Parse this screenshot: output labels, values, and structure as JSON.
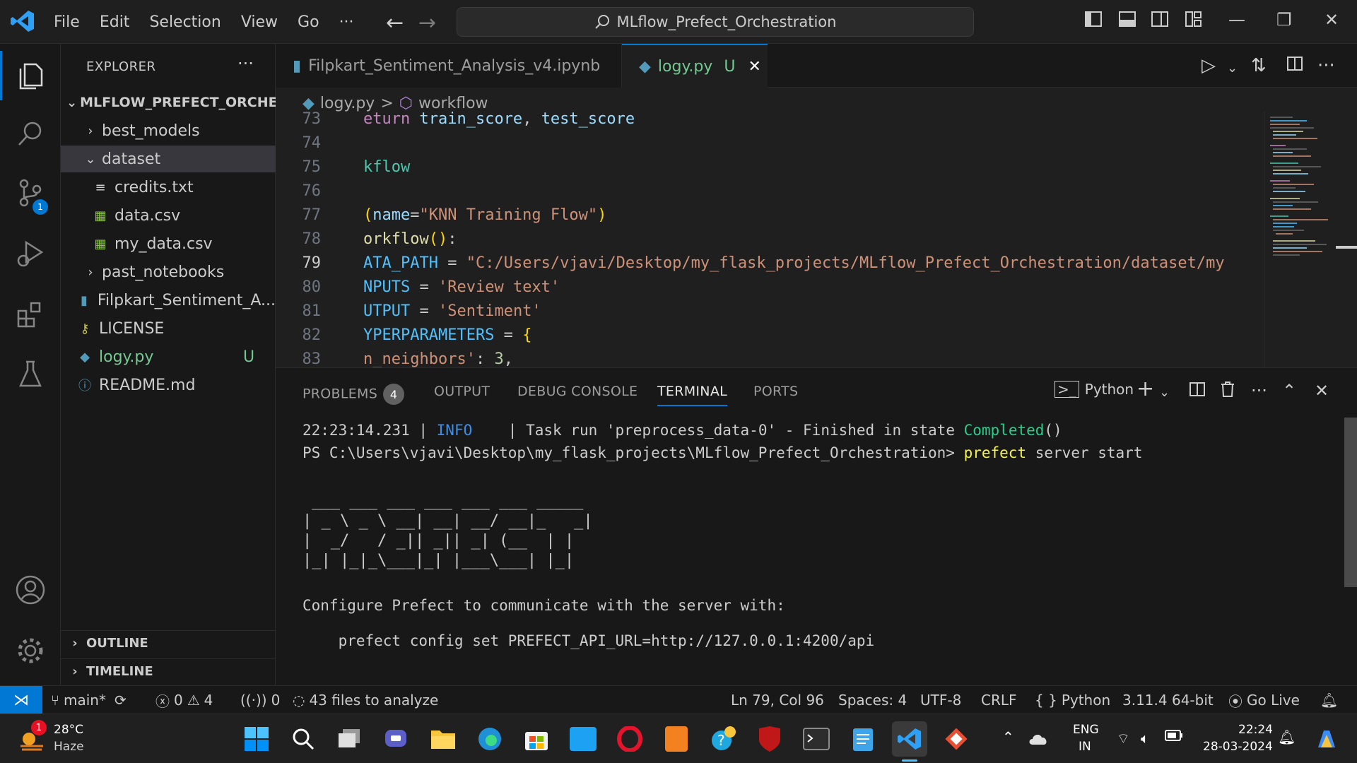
{
  "titlebar": {
    "menu": [
      "File",
      "Edit",
      "Selection",
      "View",
      "Go"
    ],
    "more": "···",
    "search_text": "MLflow_Prefect_Orchestration"
  },
  "sidebar": {
    "title": "EXPLORER",
    "more": "···",
    "root": "MLFLOW_PREFECT_ORCHE...",
    "items": [
      {
        "label": "best_models",
        "type": "folder-collapsed"
      },
      {
        "label": "dataset",
        "type": "folder-expanded"
      },
      {
        "label": "credits.txt",
        "type": "txt"
      },
      {
        "label": "data.csv",
        "type": "csv"
      },
      {
        "label": "my_data.csv",
        "type": "csv"
      },
      {
        "label": "past_notebooks",
        "type": "folder-collapsed"
      },
      {
        "label": "Filpkart_Sentiment_A...",
        "type": "notebook"
      },
      {
        "label": "LICENSE",
        "type": "license"
      },
      {
        "label": "logy.py",
        "type": "python",
        "status": "U"
      },
      {
        "label": "README.md",
        "type": "info"
      }
    ],
    "outline": "OUTLINE",
    "timeline": "TIMELINE"
  },
  "tabs": [
    {
      "label": "Filpkart_Sentiment_Analysis_v4.ipynb",
      "active": false
    },
    {
      "label": "logy.py",
      "status": "U",
      "active": true
    }
  ],
  "breadcrumb": {
    "file": "logy.py",
    "separator": ">",
    "symbol": "workflow"
  },
  "code": [
    {
      "ln": "73",
      "text": "eturn train_score, test_score"
    },
    {
      "ln": "74",
      "text": ""
    },
    {
      "ln": "75",
      "text": "kflow"
    },
    {
      "ln": "76",
      "text": ""
    },
    {
      "ln": "77",
      "text": "(name=\"KNN Training Flow\")"
    },
    {
      "ln": "78",
      "text": "orkflow():"
    },
    {
      "ln": "79",
      "text": "ATA_PATH = \"C:/Users/vjavi/Desktop/my_flask_projects/MLflow_Prefect_Orchestration/dataset/my"
    },
    {
      "ln": "80",
      "text": "NPUTS = 'Review text'"
    },
    {
      "ln": "81",
      "text": "UTPUT = 'Sentiment'"
    },
    {
      "ln": "82",
      "text": "YPERPARAMETERS = {"
    },
    {
      "ln": "83",
      "text": "n_neighbors': 3,"
    }
  ],
  "panel": {
    "tabs": [
      "PROBLEMS",
      "OUTPUT",
      "DEBUG CONSOLE",
      "TERMINAL",
      "PORTS"
    ],
    "problems_count": "4",
    "active": "TERMINAL",
    "shell": "Python"
  },
  "terminal": {
    "line1_time": "22:23:14.231 | ",
    "line1_level": "INFO",
    "line1_msg": "    | Task run 'preprocess_data-0' - Finished in state ",
    "line1_state": "Completed",
    "line1_end": "()",
    "prompt": "PS C:\\Users\\vjavi\\Desktop\\my_flask_projects\\MLflow_Prefect_Orchestration> ",
    "cmd_word": "prefect",
    "cmd_rest": " server start",
    "banner": [
      " ___ ___ ___ ___ ___ ___ _____",
      "| _ \\ _ \\ __| __| __/ __|_   _|",
      "|  _/   / _|| _|| _| (__  | |",
      "|_| |_|_\\___|_| |___\\___| |_|"
    ],
    "configure": "Configure Prefect to communicate with the server with:",
    "config_cmd": "    prefect config set PREFECT_API_URL=http://127.0.0.1:4200/api"
  },
  "statusbar": {
    "branch": "main*",
    "errors": "0",
    "warnings": "4",
    "ports": "0",
    "analyze": "43 files to analyze",
    "position": "Ln 79, Col 96",
    "spaces": "Spaces: 4",
    "encoding": "UTF-8",
    "eol": "CRLF",
    "language": "Python",
    "interpreter": "3.11.4 64-bit",
    "golive": "Go Live"
  },
  "taskbar": {
    "weather_temp": "28°C",
    "weather_desc": "Haze",
    "weather_badge": "1",
    "lang1": "ENG",
    "lang2": "IN",
    "time": "22:24",
    "date": "28-03-2024"
  },
  "colors": {
    "accent": "#0078d4",
    "untracked": "#73c991",
    "string": "#ce9178",
    "variable": "#4fc1ff",
    "completed": "#23d18b",
    "info": "#3b8eea",
    "prefect": "#f5f543"
  }
}
